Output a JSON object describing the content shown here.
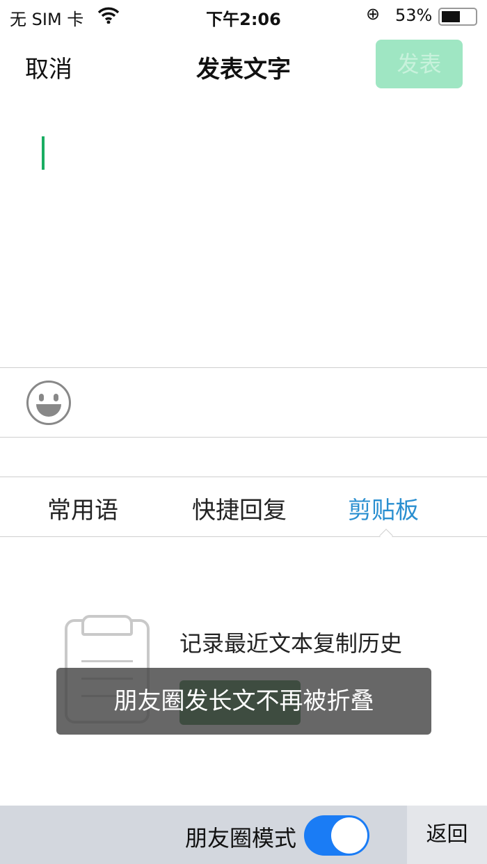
{
  "status": {
    "carrier": "无 SIM 卡",
    "time": "下午2:06",
    "battery": "53%",
    "battery_level": 0.53
  },
  "nav": {
    "cancel": "取消",
    "title": "发表文字",
    "post": "发表"
  },
  "tabs": [
    {
      "label": "常用语",
      "active": false
    },
    {
      "label": "快捷回复",
      "active": false
    },
    {
      "label": "剪贴板",
      "active": true
    }
  ],
  "clipboard": {
    "description": "记录最近文本复制历史"
  },
  "toast": "朋友圈发长文不再被折叠",
  "bottom": {
    "mode_label": "朋友圈模式",
    "mode_on": true,
    "back": "返回"
  },
  "colors": {
    "accent": "#1aad62",
    "tab_active": "#2a8fd0",
    "toggle": "#1a7cf5"
  }
}
